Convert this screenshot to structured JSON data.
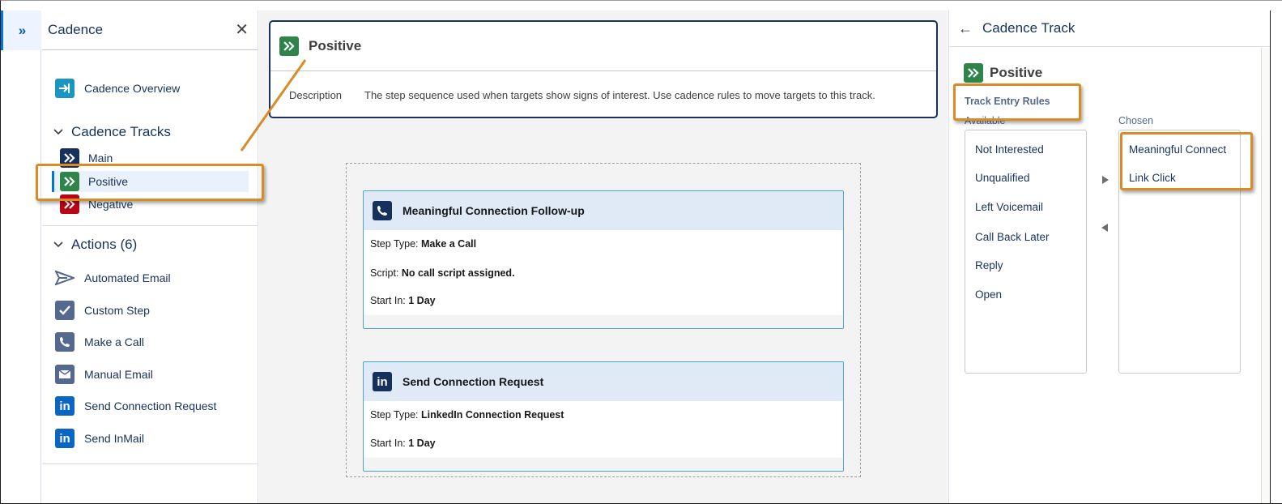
{
  "colors": {
    "brand_blue": "#0176d3",
    "navy_text": "#16325c",
    "main_track": "#16325c",
    "positive_track": "#2e844a",
    "negative_track": "#ba0517",
    "cadence_icon": "#1b96c1",
    "action_icon": "#5867e8",
    "callout_orange": "#d98c26"
  },
  "left_panel": {
    "title": "Cadence",
    "overview_label": "Cadence Overview",
    "tracks_section": "Cadence Tracks",
    "tracks": [
      {
        "label": "Main",
        "icon": "double-chevron-icon"
      },
      {
        "label": "Positive",
        "icon": "double-chevron-icon",
        "selected": true
      },
      {
        "label": "Negative",
        "icon": "double-chevron-icon"
      }
    ],
    "actions_section": "Actions (6)",
    "actions": [
      {
        "label": "Automated Email",
        "icon": "send-icon"
      },
      {
        "label": "Custom Step",
        "icon": "check-icon"
      },
      {
        "label": "Make a Call",
        "icon": "phone-icon"
      },
      {
        "label": "Manual Email",
        "icon": "email-icon"
      },
      {
        "label": "Send Connection Request",
        "icon": "linkedin-icon"
      },
      {
        "label": "Send InMail",
        "icon": "linkedin-icon"
      }
    ]
  },
  "track_header": {
    "title": "Positive",
    "description_label": "Description",
    "description": "The step sequence used when targets show signs of interest. Use cadence rules to move targets to this track."
  },
  "steps": [
    {
      "title": "Meaningful Connection Follow-up",
      "icon": "phone-icon",
      "lines": [
        {
          "label": "Step Type: ",
          "value": "Make a Call"
        },
        {
          "label": "Script: ",
          "value": "No call script assigned."
        },
        {
          "label": "Start In: ",
          "value": "1 Day"
        }
      ]
    },
    {
      "title": "Send Connection Request",
      "icon": "linkedin-icon",
      "lines": [
        {
          "label": "Step Type: ",
          "value": "LinkedIn Connection Request"
        },
        {
          "label": "Start In: ",
          "value": "1 Day"
        }
      ]
    }
  ],
  "right_panel": {
    "title": "Cadence Track",
    "track_name": "Positive",
    "rules_title": "Track Entry Rules",
    "available_label": "Available",
    "chosen_label": "Chosen",
    "available": [
      "Not Interested",
      "Unqualified",
      "Left Voicemail",
      "Call Back Later",
      "Reply",
      "Open"
    ],
    "chosen": [
      "Meaningful Connect",
      "Link Click"
    ]
  }
}
